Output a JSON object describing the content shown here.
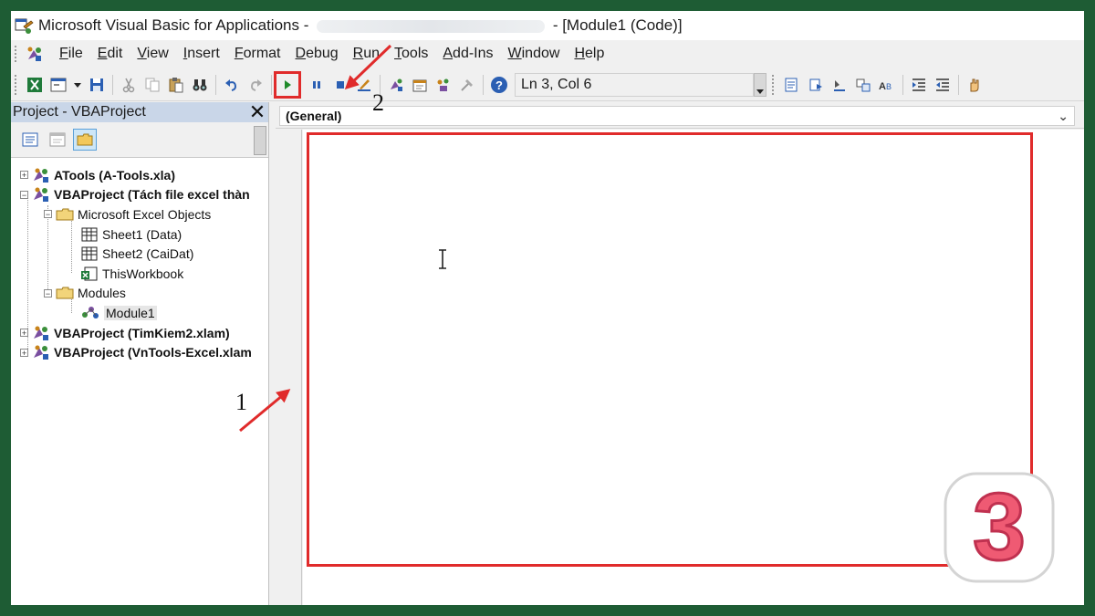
{
  "window": {
    "title_prefix": "Microsoft Visual Basic for Applications - ",
    "title_suffix": " - [Module1 (Code)]"
  },
  "menu": [
    "File",
    "Edit",
    "View",
    "Insert",
    "Format",
    "Debug",
    "Run",
    "Tools",
    "Add-Ins",
    "Window",
    "Help"
  ],
  "toolbar": {
    "position_text": "Ln 3, Col 6"
  },
  "project_pane": {
    "title": "Project - VBAProject",
    "close_label": "✕",
    "tree": [
      {
        "label": "ATools (A-Tools.xla)",
        "level": 0,
        "bold": true,
        "expander": "+",
        "icon": "vba-project-icon"
      },
      {
        "label": "VBAProject (Tách file excel thàn",
        "level": 0,
        "bold": true,
        "expander": "−",
        "icon": "vba-project-icon"
      },
      {
        "label": "Microsoft Excel Objects",
        "level": 1,
        "bold": false,
        "expander": "−",
        "icon": "folder-icon"
      },
      {
        "label": "Sheet1 (Data)",
        "level": 2,
        "bold": false,
        "expander": "",
        "icon": "sheet-icon"
      },
      {
        "label": "Sheet2 (CaiDat)",
        "level": 2,
        "bold": false,
        "expander": "",
        "icon": "sheet-icon"
      },
      {
        "label": "ThisWorkbook",
        "level": 2,
        "bold": false,
        "expander": "",
        "icon": "workbook-icon"
      },
      {
        "label": "Modules",
        "level": 1,
        "bold": false,
        "expander": "−",
        "icon": "folder-icon"
      },
      {
        "label": "Module1",
        "level": 2,
        "bold": false,
        "expander": "",
        "icon": "module-icon",
        "selected": true
      },
      {
        "label": "VBAProject (TimKiem2.xlam)",
        "level": 0,
        "bold": true,
        "expander": "+",
        "icon": "vba-project-icon"
      },
      {
        "label": "VBAProject (VnTools-Excel.xlam",
        "level": 0,
        "bold": true,
        "expander": "+",
        "icon": "vba-project-icon"
      }
    ]
  },
  "code_window": {
    "object_combo": "(General)"
  },
  "annotations": {
    "label_1": "1",
    "label_2": "2",
    "highlight_color": "#e02b2b",
    "badge_number": "3"
  },
  "colors": {
    "frame_bg": "#1e5c34",
    "pane_header": "#c9d6e8"
  }
}
